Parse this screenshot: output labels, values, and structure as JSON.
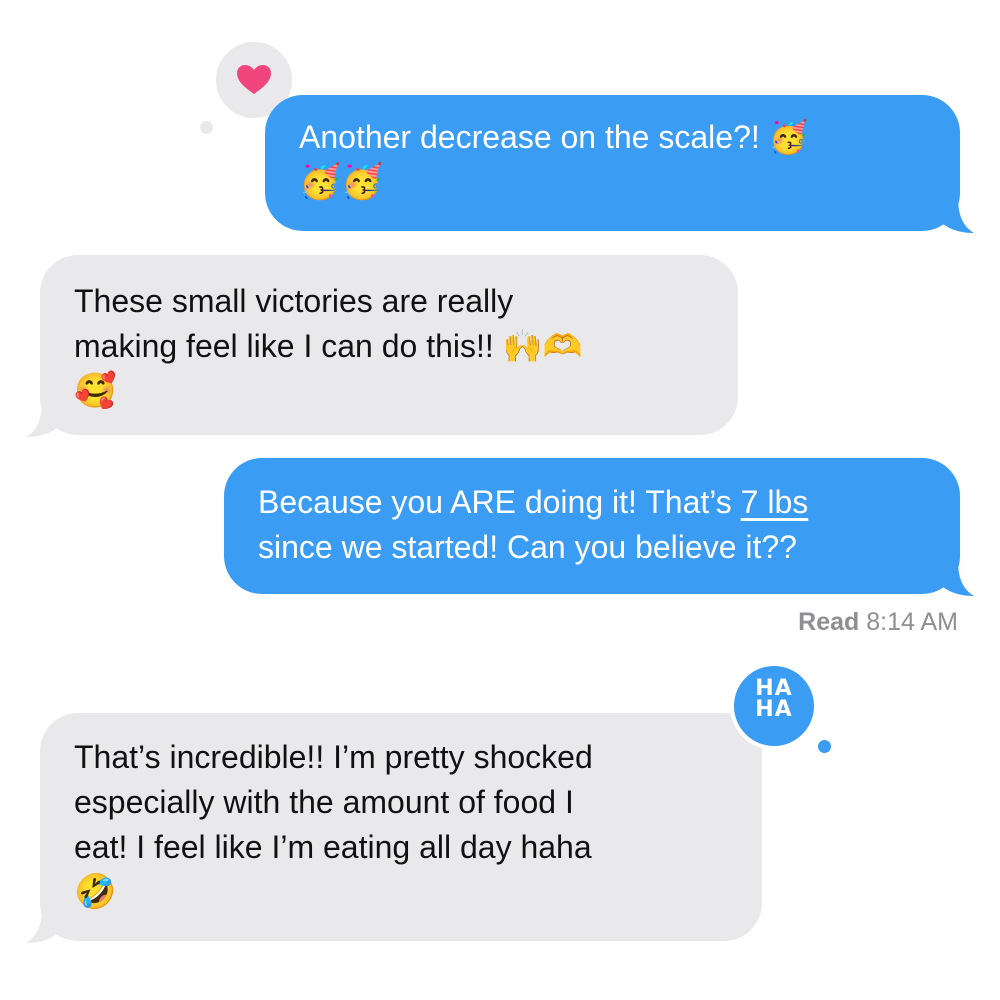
{
  "colors": {
    "sent_bubble": "#3b9cf3",
    "received_bubble": "#e9e9eb",
    "heart": "#f0467d",
    "read_receipt": "#8e8e93"
  },
  "messages": [
    {
      "direction": "sent",
      "lines": [
        "Another decrease on the scale?!"
      ],
      "emoji_inline": "🥳",
      "emoji_row": "🥳🥳",
      "tapback": "heart-icon"
    },
    {
      "direction": "received",
      "lines": [
        "These small victories are really",
        "making feel like I can do this!!"
      ],
      "emoji_inline": "🙌🫶",
      "emoji_row": "🥰"
    },
    {
      "direction": "sent",
      "line1_text": "Because you ARE doing it! That’s ",
      "line1_link": "7 lbs",
      "line2": "since we started! Can you believe it??"
    },
    {
      "direction": "received",
      "lines": [
        "That’s incredible!! I’m pretty shocked",
        "especially with the amount of food I",
        "eat! I feel like I’m eating all day haha"
      ],
      "emoji_row": "🤣",
      "tapback": "haha-icon"
    }
  ],
  "read_receipt": {
    "label": "Read",
    "time": "8:14 AM"
  },
  "tapbacks": {
    "haha_text": "HA HA"
  }
}
